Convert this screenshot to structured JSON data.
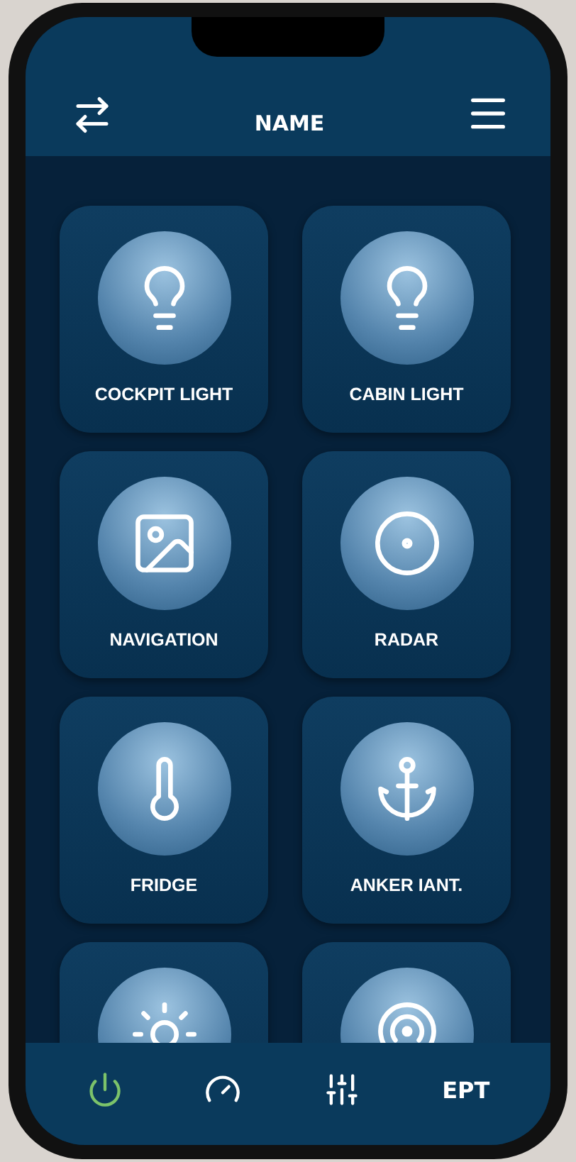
{
  "header": {
    "title": "NAME"
  },
  "tiles": [
    {
      "kind": "bulb",
      "label": "COCKPIT LIGHT"
    },
    {
      "kind": "bulb",
      "label": "CABIN LIGHT"
    },
    {
      "kind": "image",
      "label": "NAVIGATION"
    },
    {
      "kind": "radar",
      "label": "RADAR"
    },
    {
      "kind": "thermometer",
      "label": "FRIDGE"
    },
    {
      "kind": "anchor",
      "label": "ANKER IANT."
    },
    {
      "kind": "sun"
    },
    {
      "kind": "broadcast"
    }
  ],
  "nav": [
    {
      "kind": "power",
      "selected": true
    },
    {
      "kind": "gauge",
      "selected": false
    },
    {
      "kind": "sliders",
      "selected": false
    },
    {
      "kind": "text",
      "label": "EPT",
      "selected": false
    }
  ]
}
